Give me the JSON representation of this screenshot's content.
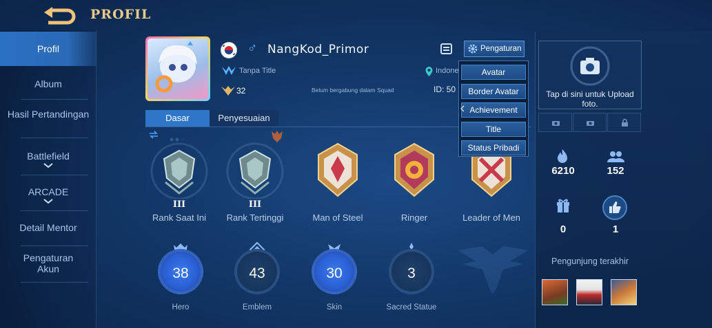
{
  "header": {
    "title": "PROFIL",
    "back_icon": "back-arrow-icon"
  },
  "sidebar": {
    "items": [
      {
        "label": "Profil",
        "active": true
      },
      {
        "label": "Album"
      },
      {
        "label": "Hasil Pertandingan"
      },
      {
        "label": "Battlefield",
        "has_chevron": true
      },
      {
        "label": "ARCADE",
        "has_chevron": true
      },
      {
        "label": "Detail Mentor"
      },
      {
        "label": "Pengaturan Akun"
      }
    ]
  },
  "profile": {
    "country_flag": "south-korea-flag-icon",
    "gender_symbol": "♂",
    "username": "NangKod_Primor",
    "title": "Tanpa Title",
    "rank_level": "32",
    "squad_status": "Belum bergabung dalam Squad",
    "location": "Indonesia",
    "id_label": "ID: 50",
    "settings_label": "Pengaturan"
  },
  "tabs": [
    {
      "label": "Dasar",
      "active": true
    },
    {
      "label": "Penyesuaian"
    }
  ],
  "badges": [
    {
      "label": "Rank Saat Ini",
      "roman": "III"
    },
    {
      "label": "Rank Tertinggi",
      "roman": "III"
    },
    {
      "label": "Man of Steel"
    },
    {
      "label": "Ringer"
    },
    {
      "label": "Leader of Men"
    }
  ],
  "stats": [
    {
      "label": "Hero",
      "value": "38",
      "color": "#3b6fe0"
    },
    {
      "label": "Emblem",
      "value": "43",
      "color": "#2aa89a"
    },
    {
      "label": "Skin",
      "value": "30",
      "color": "#3b6fe0"
    },
    {
      "label": "Sacred Statue",
      "value": "3",
      "color": "#6a8fbf"
    }
  ],
  "dropdown": {
    "items": [
      "Avatar",
      "Border Avatar",
      "Achievement",
      "Title",
      "Status Pribadi"
    ]
  },
  "right_panel": {
    "upload_text": "Tap di sini untuk Upload foto.",
    "popularity": "6210",
    "followers": "152",
    "gifts": "0",
    "likes": "1",
    "visitors_label": "Pengunjung terakhir"
  },
  "colors": {
    "accent": "#2f76c8",
    "title_gold": "#e9c98a",
    "bg": "#123767"
  }
}
